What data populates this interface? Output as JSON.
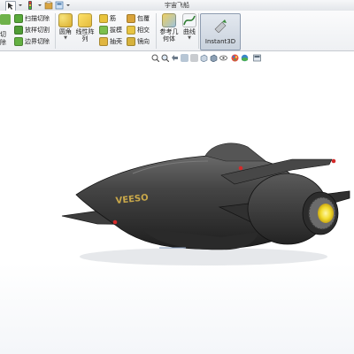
{
  "window": {
    "title": "宇宙飞船"
  },
  "colors": {
    "ribbon_bg": "#eef0f3",
    "instant3d_bg": "#c9d2dd",
    "model_body": "#3a3a3a",
    "engine_glow": "#f2dc2e",
    "accent_red": "#d42a2a"
  },
  "quick_access": {
    "icons": [
      "select-arrow-icon",
      "dropdown-arrow-icon",
      "traffic-light-icon",
      "dropdown-arrow-icon",
      "options-icon",
      "view-icon"
    ]
  },
  "ribbon": {
    "cut_group": {
      "partial_label_line1": "转切",
      "partial_label_line2": "除",
      "sweep_cut": "扫描切除",
      "loft_cut": "放样切割",
      "boundary_cut": "边界切除"
    },
    "fillet": "圆角",
    "linear_pattern_line1": "线性阵",
    "linear_pattern_line2": "列",
    "rib": "筋",
    "draft": "拔模",
    "shell": "抽壳",
    "wrap": "包覆",
    "intersect": "相交",
    "mirror": "镜向",
    "ref_geometry_line1": "参考几",
    "ref_geometry_line2": "何体",
    "curves": "曲线",
    "instant3d": "Instant3D"
  },
  "view_toolbar": {
    "icons": [
      "zoom-to-fit-icon",
      "zoom-area-icon",
      "previous-view-icon",
      "section-view-icon",
      "dynamic-annotation-icon",
      "view-orientation-icon",
      "display-style-icon",
      "hide-show-icon",
      "edit-appearance-icon",
      "apply-scene-icon",
      "view-settings-icon"
    ]
  },
  "model": {
    "hull_text": "VEESO"
  }
}
